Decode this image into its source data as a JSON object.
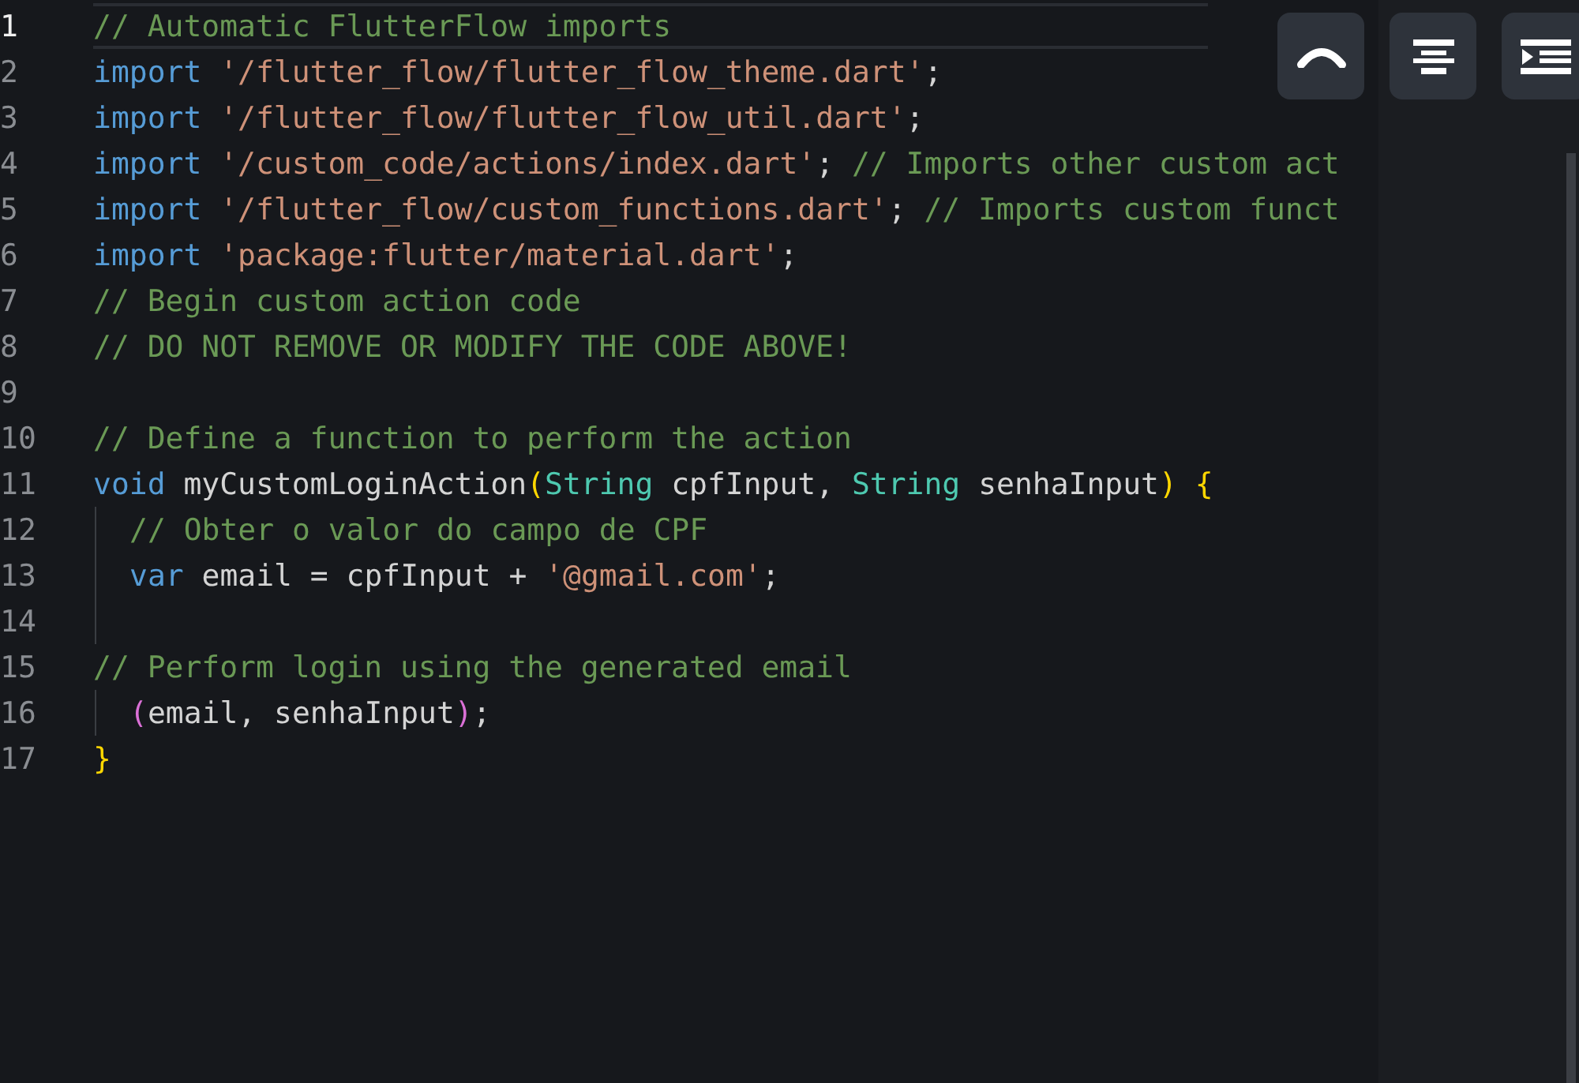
{
  "editor": {
    "lines": [
      {
        "number": "1",
        "active": true,
        "indent": false,
        "tokens": [
          {
            "kind": "comment",
            "text": "// Automatic FlutterFlow imports"
          }
        ]
      },
      {
        "number": "2",
        "active": false,
        "indent": false,
        "tokens": [
          {
            "kind": "keyword",
            "text": "import"
          },
          {
            "kind": "string",
            "text": " '/flutter_flow/flutter_flow_theme.dart'"
          },
          {
            "kind": "plain",
            "text": ";"
          }
        ]
      },
      {
        "number": "3",
        "active": false,
        "indent": false,
        "tokens": [
          {
            "kind": "keyword",
            "text": "import"
          },
          {
            "kind": "string",
            "text": " '/flutter_flow/flutter_flow_util.dart'"
          },
          {
            "kind": "plain",
            "text": ";"
          }
        ]
      },
      {
        "number": "4",
        "active": false,
        "indent": false,
        "tokens": [
          {
            "kind": "keyword",
            "text": "import"
          },
          {
            "kind": "string",
            "text": " '/custom_code/actions/index.dart'"
          },
          {
            "kind": "plain",
            "text": "; "
          },
          {
            "kind": "comment",
            "text": "// Imports other custom act"
          }
        ]
      },
      {
        "number": "5",
        "active": false,
        "indent": false,
        "tokens": [
          {
            "kind": "keyword",
            "text": "import"
          },
          {
            "kind": "string",
            "text": " '/flutter_flow/custom_functions.dart'"
          },
          {
            "kind": "plain",
            "text": "; "
          },
          {
            "kind": "comment",
            "text": "// Imports custom funct"
          }
        ]
      },
      {
        "number": "6",
        "active": false,
        "indent": false,
        "tokens": [
          {
            "kind": "keyword",
            "text": "import"
          },
          {
            "kind": "string",
            "text": " 'package:flutter/material.dart'"
          },
          {
            "kind": "plain",
            "text": ";"
          }
        ]
      },
      {
        "number": "7",
        "active": false,
        "indent": false,
        "tokens": [
          {
            "kind": "comment",
            "text": "// Begin custom action code"
          }
        ]
      },
      {
        "number": "8",
        "active": false,
        "indent": false,
        "tokens": [
          {
            "kind": "comment",
            "text": "// DO NOT REMOVE OR MODIFY THE CODE ABOVE!"
          }
        ]
      },
      {
        "number": "9",
        "active": false,
        "indent": false
      },
      {
        "number": "10",
        "active": false,
        "indent": false,
        "tokens": [
          {
            "kind": "comment",
            "text": "// Define a function to perform the action"
          }
        ]
      },
      {
        "number": "11",
        "active": false,
        "indent": false,
        "tokens": [
          {
            "kind": "keyword",
            "text": "void"
          },
          {
            "kind": "plain",
            "text": " myCustomLoginAction"
          },
          {
            "kind": "bracket",
            "text": "("
          },
          {
            "kind": "type",
            "text": "String"
          },
          {
            "kind": "plain",
            "text": " cpfInput, "
          },
          {
            "kind": "type",
            "text": "String"
          },
          {
            "kind": "plain",
            "text": " senhaInput"
          },
          {
            "kind": "bracket",
            "text": ") {"
          }
        ]
      },
      {
        "number": "12",
        "active": false,
        "indent": true,
        "tokens": [
          {
            "kind": "comment",
            "text": "// Obter o valor do campo de CPF"
          }
        ]
      },
      {
        "number": "13",
        "active": false,
        "indent": true,
        "tokens": [
          {
            "kind": "keyword",
            "text": "var"
          },
          {
            "kind": "plain",
            "text": " email = cpfInput + "
          },
          {
            "kind": "string",
            "text": "'@gmail.com'"
          },
          {
            "kind": "plain",
            "text": ";"
          }
        ]
      },
      {
        "number": "14",
        "active": false,
        "indent": true
      },
      {
        "number": "15",
        "active": false,
        "indent": false,
        "tokens": [
          {
            "kind": "comment",
            "text": "// Perform login using the generated email"
          }
        ]
      },
      {
        "number": "16",
        "active": false,
        "indent": true,
        "tokens": [
          {
            "kind": "bracket2",
            "text": "("
          },
          {
            "kind": "plain",
            "text": "email, senhaInput"
          },
          {
            "kind": "bracket2",
            "text": ")"
          },
          {
            "kind": "plain",
            "text": ";"
          }
        ]
      },
      {
        "number": "17",
        "active": false,
        "indent": false,
        "tokens": [
          {
            "kind": "bracket",
            "text": "}"
          }
        ]
      }
    ]
  },
  "toolbar": [
    {
      "kind": "undo"
    },
    {
      "kind": "center"
    },
    {
      "kind": "indent"
    }
  ]
}
